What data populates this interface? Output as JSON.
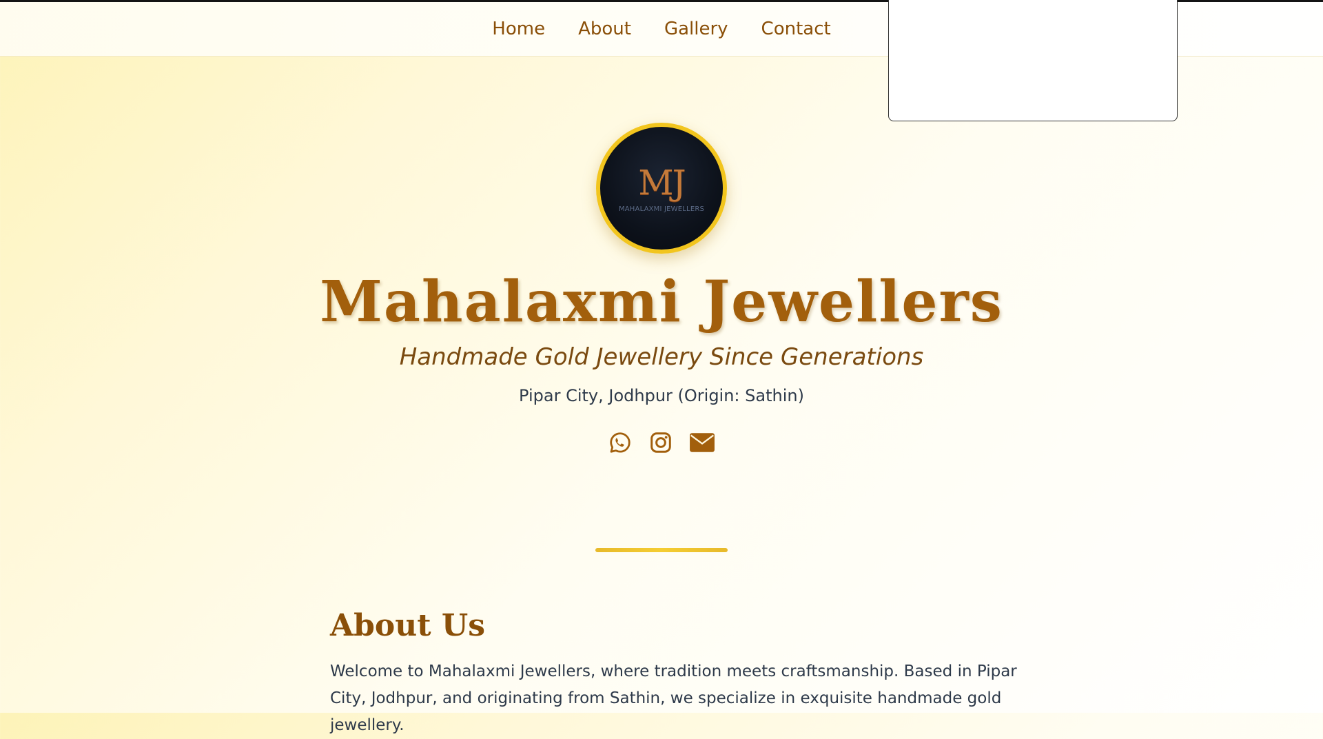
{
  "nav": {
    "links": [
      "Home",
      "About",
      "Gallery",
      "Contact"
    ]
  },
  "hero": {
    "logo_mark": "MJ",
    "logo_sub": "MAHALAXMI JEWELLERS",
    "title": "Mahalaxmi Jewellers",
    "tagline": "Handmade Gold Jewellery Since Generations",
    "location": "Pipar City, Jodhpur (Origin: Sathin)",
    "social_icons": [
      "whatsapp-icon",
      "instagram-icon",
      "email-icon"
    ]
  },
  "about": {
    "title": "About Us",
    "text": "Welcome to Mahalaxmi Jewellers, where tradition meets craftsmanship. Based in Pipar City, Jodhpur, and originating from Sathin, we specialize in exquisite handmade gold jewellery."
  },
  "colors": {
    "accent": "#a25f0c",
    "gold": "#f2c51e",
    "nav_text": "#8a4f08",
    "body_text": "#2e3a4a"
  }
}
